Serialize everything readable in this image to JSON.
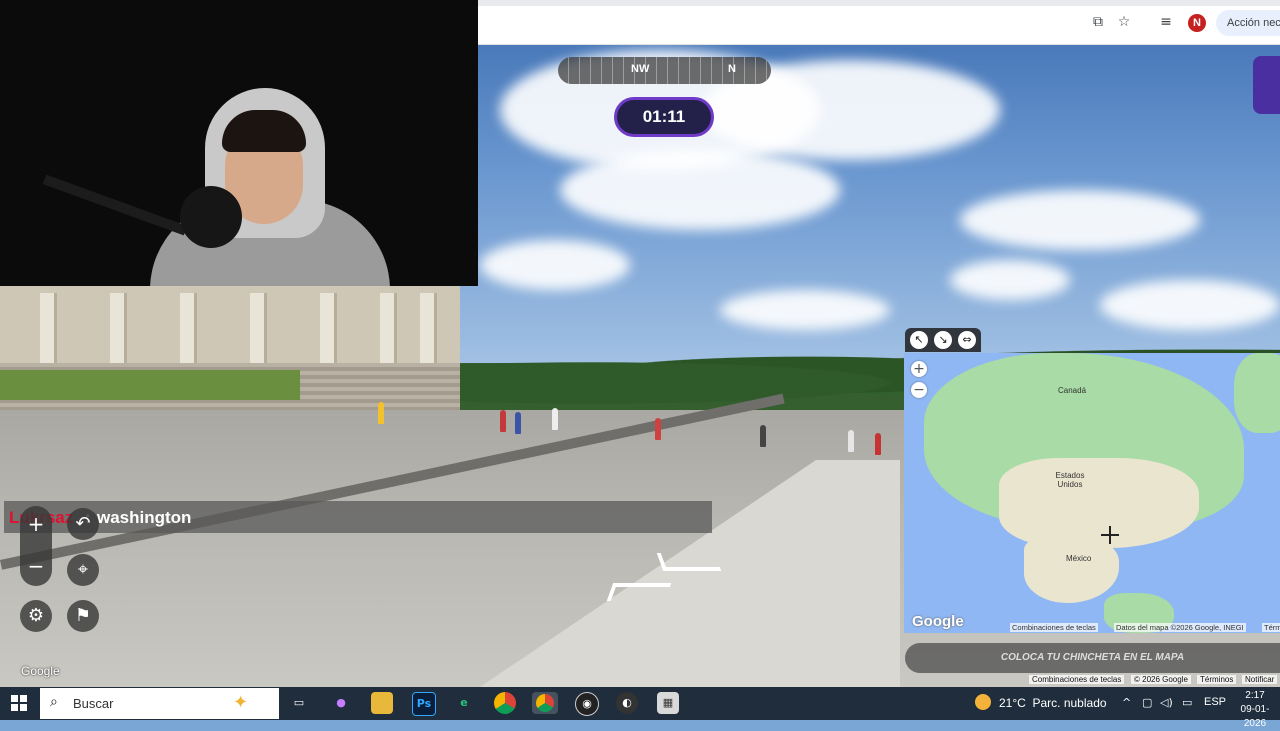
{
  "browser": {
    "action_button_label": "Acción nece",
    "profile_initial": "N"
  },
  "game": {
    "compass": [
      "NW",
      "N"
    ],
    "timer": "01:11",
    "map_action_label": "COLOCA TU CHINCHETA EN EL MAPA",
    "streetview_watermark": "Google"
  },
  "chat": {
    "username": "Lukrsaz",
    "separator": ":",
    "message": "washington"
  },
  "map": {
    "labels": [
      "Canadá",
      "Estados Unidos",
      "México"
    ],
    "google_logo": "Google",
    "attribution": [
      "Combinaciones de teclas",
      "Datos del mapa ©2026 Google, INEGI",
      "Térm"
    ],
    "footer": [
      "Combinaciones de teclas",
      "© 2026 Google",
      "Términos",
      "Notificar"
    ]
  },
  "taskbar": {
    "search_placeholder": "Buscar",
    "photoshop_label": "Ps",
    "weather_temp": "21°C",
    "weather_text": "Parc. nublado",
    "language": "ESP",
    "time": "2:17",
    "date": "09-01-2026"
  },
  "colors": {
    "timer_border": "#6f3ac8",
    "chat_username": "#e0102e",
    "taskbar_bg": "#1f2d3c"
  }
}
